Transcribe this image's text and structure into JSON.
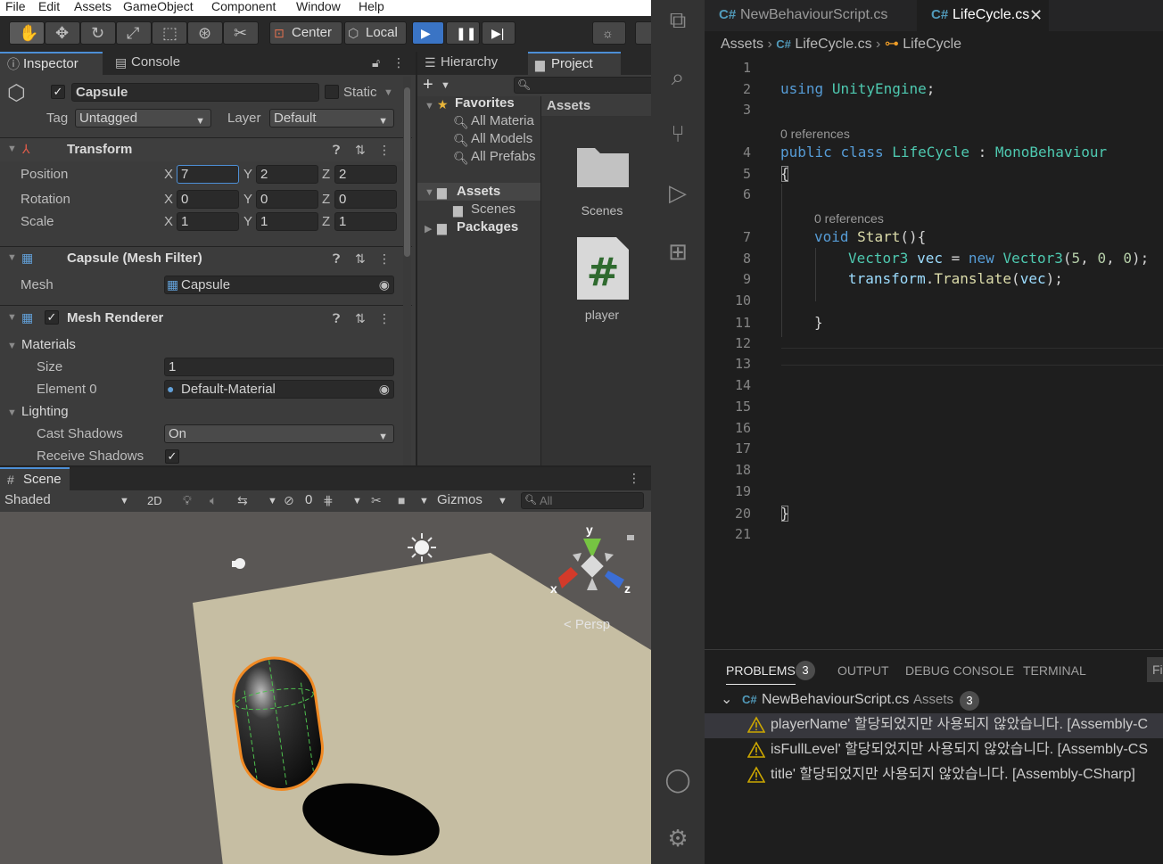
{
  "menu": [
    "File",
    "Edit",
    "Assets",
    "GameObject",
    "Component",
    "Window",
    "Help"
  ],
  "toolbar": {
    "pivot": "Center",
    "space": "Local"
  },
  "inspector": {
    "tabs": [
      "Inspector",
      "Console"
    ],
    "object_name": "Capsule",
    "static_label": "Static",
    "tag_label": "Tag",
    "tag_value": "Untagged",
    "layer_label": "Layer",
    "layer_value": "Default",
    "transform": {
      "title": "Transform",
      "rows": [
        {
          "label": "Position",
          "x": "7",
          "y": "2",
          "z": "2"
        },
        {
          "label": "Rotation",
          "x": "0",
          "y": "0",
          "z": "0"
        },
        {
          "label": "Scale",
          "x": "1",
          "y": "1",
          "z": "1"
        }
      ],
      "axes": [
        "X",
        "Y",
        "Z"
      ]
    },
    "mesh_filter": {
      "title": "Capsule (Mesh Filter)",
      "mesh_label": "Mesh",
      "mesh_value": "Capsule"
    },
    "mesh_renderer": {
      "title": "Mesh Renderer",
      "materials": "Materials",
      "size_label": "Size",
      "size_value": "1",
      "element_label": "Element 0",
      "element_value": "Default-Material",
      "lighting": "Lighting",
      "cast_label": "Cast Shadows",
      "cast_value": "On",
      "receive_label": "Receive Shadows"
    }
  },
  "project": {
    "tabs": [
      "Hierarchy",
      "Project"
    ],
    "favorites": "Favorites",
    "fav_items": [
      "All Materia",
      "All Models",
      "All Prefabs"
    ],
    "assets": "Assets",
    "asset_items": [
      "Scenes"
    ],
    "packages": "Packages",
    "breadcrumb": "Assets",
    "grid": [
      {
        "name": "Scenes"
      },
      {
        "name": "player"
      }
    ]
  },
  "scene": {
    "tab": "Scene",
    "shading": "Shaded",
    "mode_2d": "2D",
    "hidden_count": "0",
    "gizmos": "Gizmos",
    "search_placeholder": "All",
    "persp": "< Persp",
    "axes": {
      "x": "x",
      "y": "y",
      "z": "z"
    }
  },
  "vscode": {
    "tabs": [
      "NewBehaviourScript.cs",
      "LifeCycle.cs"
    ],
    "breadcrumb": [
      "Assets",
      "LifeCycle.cs",
      "LifeCycle"
    ],
    "refs": "0 references",
    "line_numbers": [
      "1",
      "2",
      "3",
      "4",
      "5",
      "6",
      "7",
      "8",
      "9",
      "10",
      "11",
      "12",
      "13",
      "14",
      "15",
      "16",
      "17",
      "18",
      "19",
      "20",
      "21"
    ],
    "panel_tabs": [
      "PROBLEMS",
      "OUTPUT",
      "DEBUG CONSOLE",
      "TERMINAL"
    ],
    "problem_count": "3",
    "panel_filter": "Fi",
    "problem_file": "NewBehaviourScript.cs",
    "problem_folder": "Assets",
    "problems": [
      "playerName' 할당되었지만 사용되지 않았습니다. [Assembly-C",
      "isFullLevel' 할당되었지만 사용되지 않았습니다. [Assembly-CS",
      "title' 할당되었지만 사용되지 않았습니다. [Assembly-CSharp]"
    ],
    "code": {
      "l2": [
        "using",
        "UnityEngine",
        ";"
      ],
      "l4": [
        "public",
        "class",
        "LifeCycle",
        ":",
        "MonoBehaviour"
      ],
      "l5": "{",
      "l7": [
        "void",
        "Start",
        "(){"
      ],
      "l8": [
        "Vector3",
        "vec",
        "=",
        "new",
        "Vector3",
        "(",
        "5",
        ", ",
        "0",
        ", ",
        "0",
        ");"
      ],
      "l9": [
        "transform",
        ".",
        "Translate",
        "(",
        "vec",
        ");"
      ],
      "l11": "}",
      "l20": "}"
    }
  },
  "colors": {
    "accent": "#4d8fd6",
    "selection_outline": "#f08a24",
    "play_bg": "#3a74c5",
    "warning": "#cca700"
  }
}
